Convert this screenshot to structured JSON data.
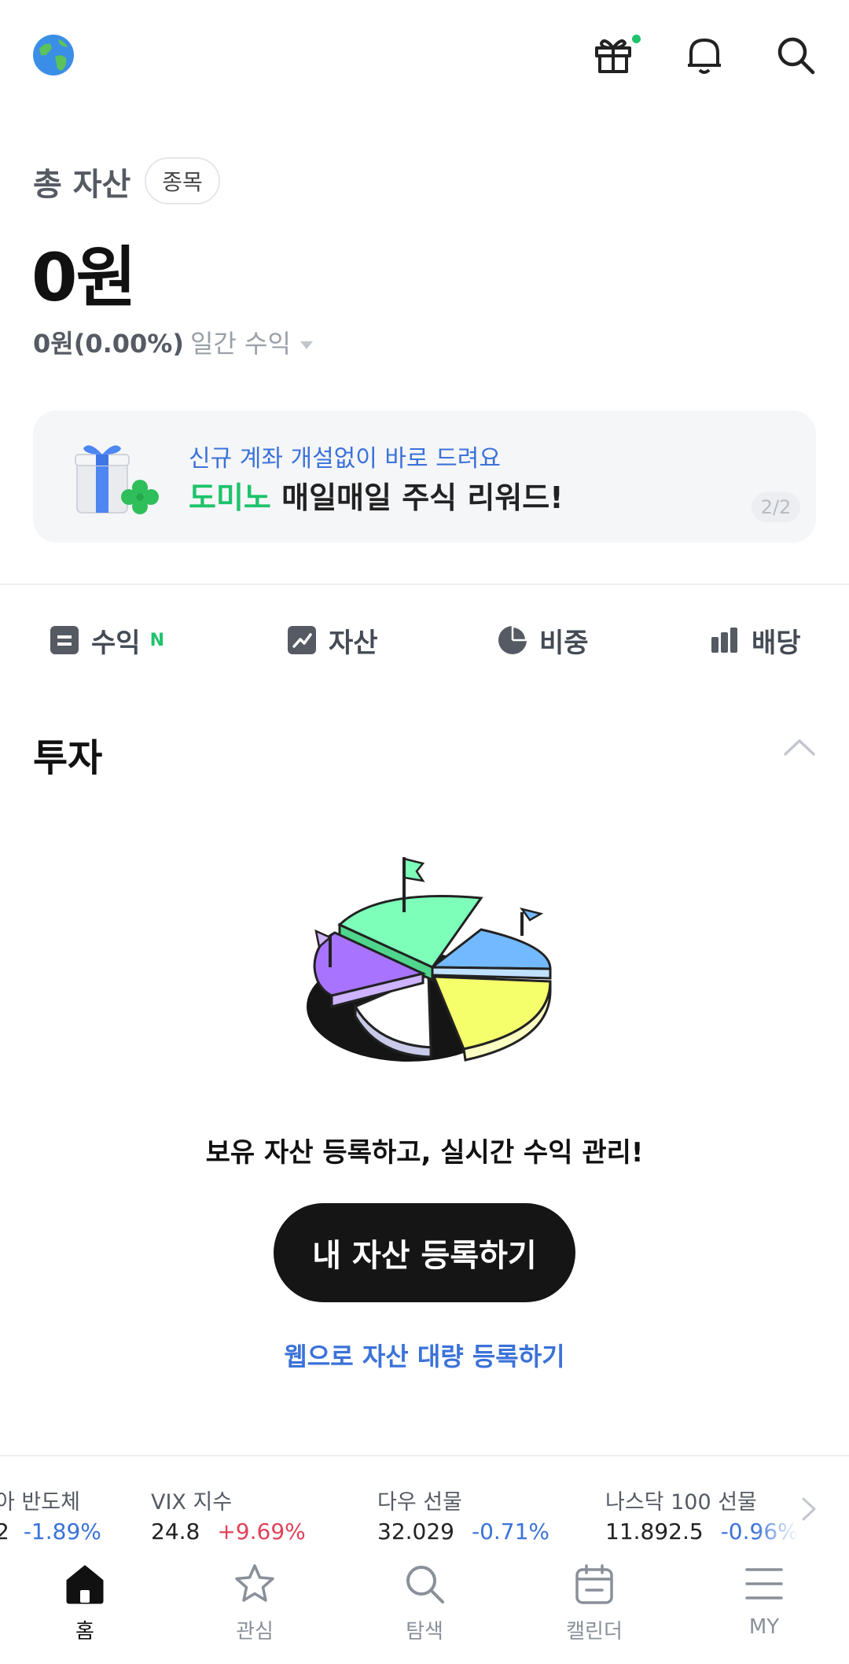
{
  "header": {
    "logo_icon": "globe-icon",
    "gift_icon": "gift-icon",
    "bell_icon": "bell-icon",
    "search_icon": "search-icon",
    "dot_color": "#1ec36b"
  },
  "summary": {
    "label": "총 자산",
    "chip": "종목",
    "amount": "0원",
    "daily_value": "0원(0.00%)",
    "daily_label": "일간 수익"
  },
  "banner": {
    "subtitle": "신규 계좌 개설없이 바로 드려요",
    "title_highlight": "도미노",
    "title_rest": " 매일매일 주식 리워드!",
    "pager": "2/2"
  },
  "tabs": [
    {
      "label": "수익",
      "badge": "N",
      "icon": "receipt-icon"
    },
    {
      "label": "자산",
      "icon": "trend-chart-icon"
    },
    {
      "label": "비중",
      "icon": "pie-chart-icon"
    },
    {
      "label": "배당",
      "icon": "bar-chart-icon"
    }
  ],
  "investment": {
    "title": "투자",
    "empty_message": "보유 자산 등록하고, 실시간 수익 관리!",
    "cta": "내 자산 등록하기",
    "web_link": "웹으로 자산 대량 등록하기"
  },
  "ticker": [
    {
      "name": "아 반도체",
      "value": "2",
      "change": "-1.89%",
      "dir": "neg"
    },
    {
      "name": "VIX 지수",
      "value": "24.8",
      "change": "+9.69%",
      "dir": "pos"
    },
    {
      "name": "다우 선물",
      "value": "32.029",
      "change": "-0.71%",
      "dir": "neg"
    },
    {
      "name": "나스닥 100 선물",
      "value": "11.892.5",
      "change": "-0.96%",
      "dir": "neg"
    }
  ],
  "nav": [
    {
      "label": "홈",
      "icon": "home-icon"
    },
    {
      "label": "관심",
      "icon": "star-icon"
    },
    {
      "label": "탐색",
      "icon": "search-icon"
    },
    {
      "label": "캘린더",
      "icon": "calendar-icon"
    },
    {
      "label": "MY",
      "icon": "menu-icon"
    }
  ]
}
